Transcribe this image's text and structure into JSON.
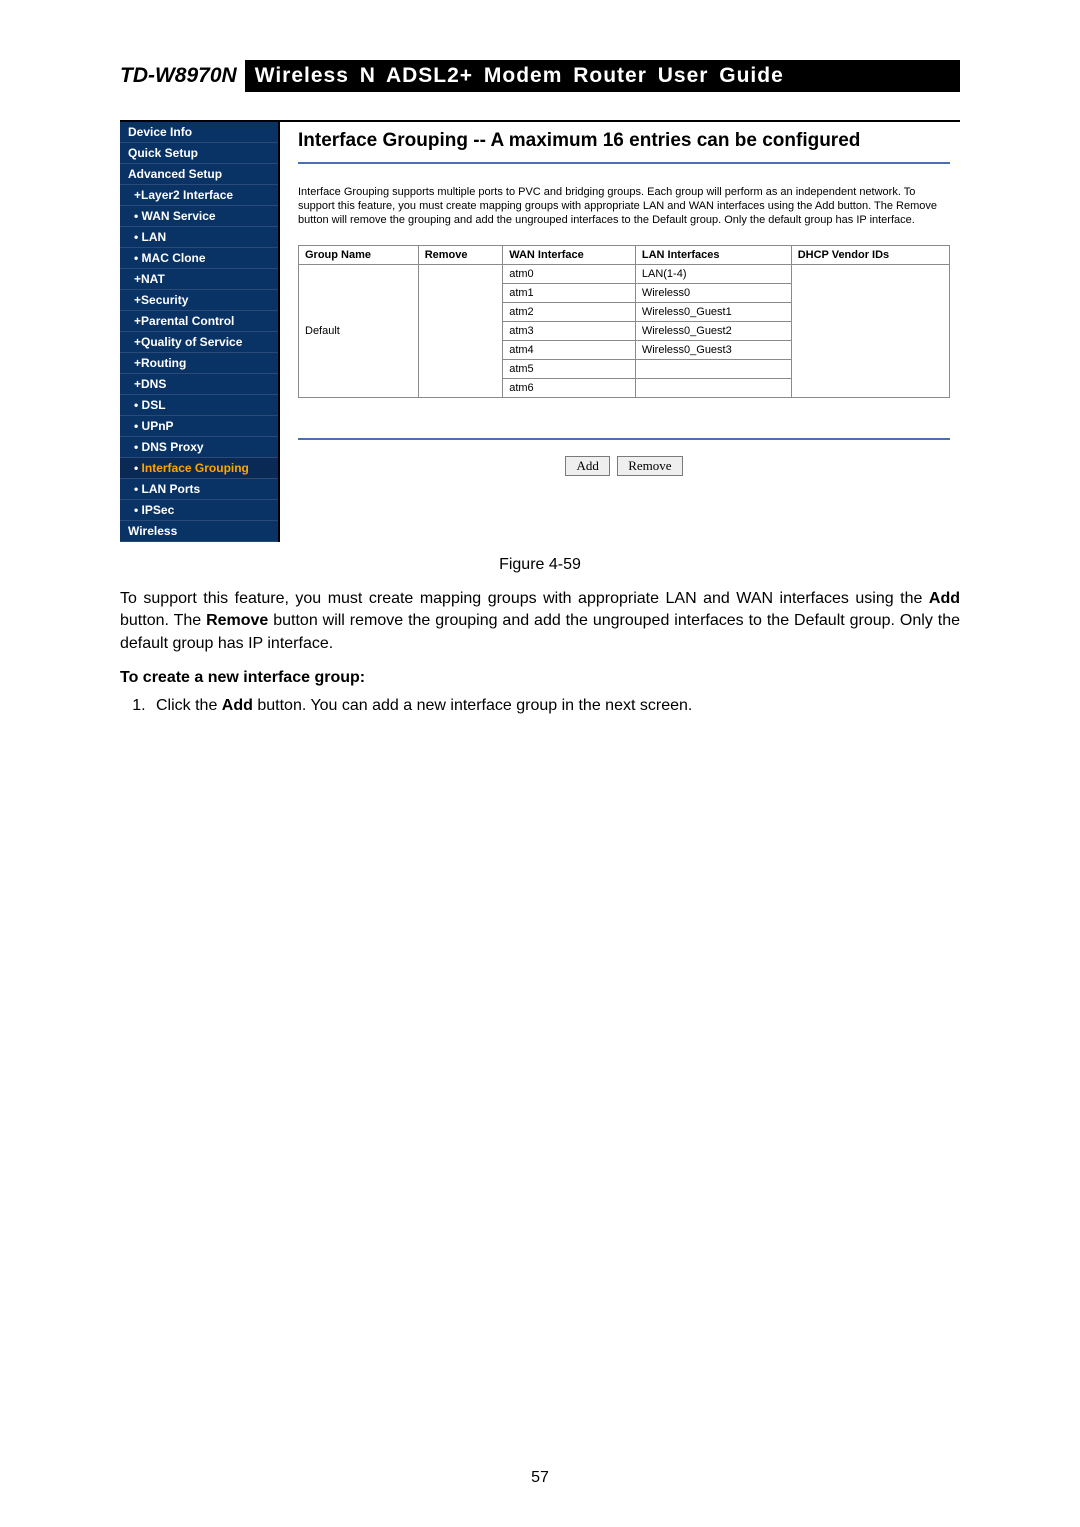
{
  "header": {
    "model": "TD-W8970N",
    "desc": "Wireless  N  ADSL2+  Modem  Router  User  Guide"
  },
  "nav": {
    "items": [
      {
        "label": "Device Info",
        "cls": ""
      },
      {
        "label": "Quick Setup",
        "cls": ""
      },
      {
        "label": "Advanced Setup",
        "cls": ""
      },
      {
        "label": "Layer2 Interface",
        "cls": "sub plus"
      },
      {
        "label": "WAN Service",
        "cls": "sub bullet"
      },
      {
        "label": "LAN",
        "cls": "sub bullet"
      },
      {
        "label": "MAC Clone",
        "cls": "sub bullet"
      },
      {
        "label": "NAT",
        "cls": "sub plus"
      },
      {
        "label": "Security",
        "cls": "sub plus"
      },
      {
        "label": "Parental Control",
        "cls": "sub plus"
      },
      {
        "label": "Quality of Service",
        "cls": "sub plus"
      },
      {
        "label": "Routing",
        "cls": "sub plus"
      },
      {
        "label": "DNS",
        "cls": "sub plus"
      },
      {
        "label": "DSL",
        "cls": "sub bullet"
      },
      {
        "label": "UPnP",
        "cls": "sub bullet"
      },
      {
        "label": "DNS Proxy",
        "cls": "sub bullet"
      },
      {
        "label": "Interface Grouping",
        "cls": "sub bullet selected"
      },
      {
        "label": "LAN Ports",
        "cls": "sub bullet"
      },
      {
        "label": "IPSec",
        "cls": "sub bullet"
      },
      {
        "label": "Wireless",
        "cls": ""
      }
    ]
  },
  "panel": {
    "title": "Interface Grouping -- A maximum 16 entries can be configured",
    "desc": "Interface Grouping supports multiple ports to PVC and bridging groups. Each group will perform as an independent network. To support this feature, you must create mapping groups with appropriate LAN and WAN interfaces using the Add button. The Remove button will remove the grouping and add the ungrouped interfaces to the Default group. Only the default group has IP interface.",
    "headers": [
      "Group Name",
      "Remove",
      "WAN Interface",
      "LAN Interfaces",
      "DHCP Vendor IDs"
    ],
    "group_name": "Default",
    "rows": [
      {
        "wan": "atm0",
        "lan": "LAN(1-4)"
      },
      {
        "wan": "atm1",
        "lan": "Wireless0"
      },
      {
        "wan": "atm2",
        "lan": "Wireless0_Guest1"
      },
      {
        "wan": "atm3",
        "lan": "Wireless0_Guest2"
      },
      {
        "wan": "atm4",
        "lan": "Wireless0_Guest3"
      },
      {
        "wan": "atm5",
        "lan": ""
      },
      {
        "wan": "atm6",
        "lan": ""
      }
    ],
    "add_label": "Add",
    "remove_label": "Remove"
  },
  "figure_caption": "Figure 4-59",
  "doc": {
    "p1_a": "To support this feature, you must create mapping groups with appropriate LAN and WAN interfaces using the ",
    "p1_b": " button. The ",
    "p1_c": " button will remove the grouping and add the ungrouped interfaces to the Default group. Only the default group has IP interface.",
    "add": "Add",
    "remove": "Remove",
    "sub": "To create a new interface group:",
    "li1_a": "Click the ",
    "li1_b": " button. You can add a new interface group in the next screen."
  },
  "page_number": "57"
}
